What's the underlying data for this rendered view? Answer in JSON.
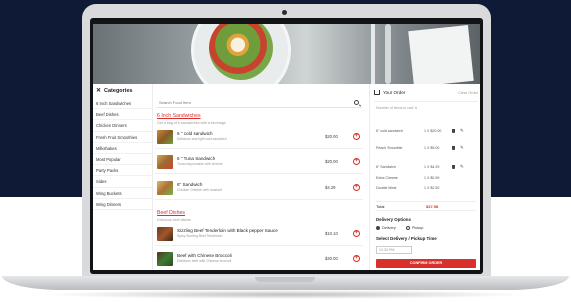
{
  "categories": {
    "title": "Categories",
    "items": [
      "6 Inch Sandwiches",
      "Beef Dishes",
      "Chicken Dinners",
      "Fresh Fruit Smoothies",
      "Milkshakes",
      "Most Popular",
      "Party Packs",
      "Sides",
      "Wing Buckets",
      "Wing Dinners"
    ]
  },
  "search": {
    "placeholder": "Search Food Item"
  },
  "sections": [
    {
      "title": "6 Inch Sandwiches",
      "subtitle": "Get a bag of 6 sandwiches with a beverage",
      "items": [
        {
          "name": "6 \" cold sandwich",
          "desc": "Delicious and light cold sandwich",
          "price": "$20.00"
        },
        {
          "name": "6 \" Tuna Sandwich",
          "desc": "Tuna mayonnaise with cheese",
          "price": "$20.00"
        },
        {
          "name": "6\" Sandwich",
          "desc": "Chicken Cheese with mustard",
          "price": "$4.29"
        }
      ]
    },
    {
      "title": "Beef Dishes",
      "subtitle": "Delicious beef dishes",
      "items": [
        {
          "name": "Sizzling Beef Tenderloin with Black pepper Sauce",
          "desc": "Spicy Sizzling Beef Tenderloin",
          "price": "$10.10"
        },
        {
          "name": "Beef with Chinese Broccoli",
          "desc": "Delicious beef with Chinese broccoli",
          "price": "$40.00"
        }
      ]
    }
  ],
  "order": {
    "title": "Your Order",
    "clear": "Clear Order",
    "count": "Number of items in cart: 6",
    "rows": [
      {
        "name": "6\" cold sandwich",
        "price": "1 X $20.00"
      },
      {
        "name": "Peach Smoothie",
        "price": "1 X $5.00"
      },
      {
        "name": "6\" Sandwich",
        "price": "1 X $4.29"
      },
      {
        "name": "Extra Cheese",
        "price": "1 X $0.99"
      },
      {
        "name": "Double Meat",
        "price": "1 X $2.50"
      }
    ],
    "total_label": "Total",
    "total_value": "$37.98",
    "delivery_options_label": "Delivery Options",
    "delivery": "Delivery",
    "pickup": "Pickup",
    "time_label": "Select Delivery / Pickup Time",
    "time_value": "12:30 PM",
    "confirm": "CONFIRM ORDER"
  },
  "colors": {
    "accent": "#d9302c",
    "background": "#0f1b36"
  }
}
